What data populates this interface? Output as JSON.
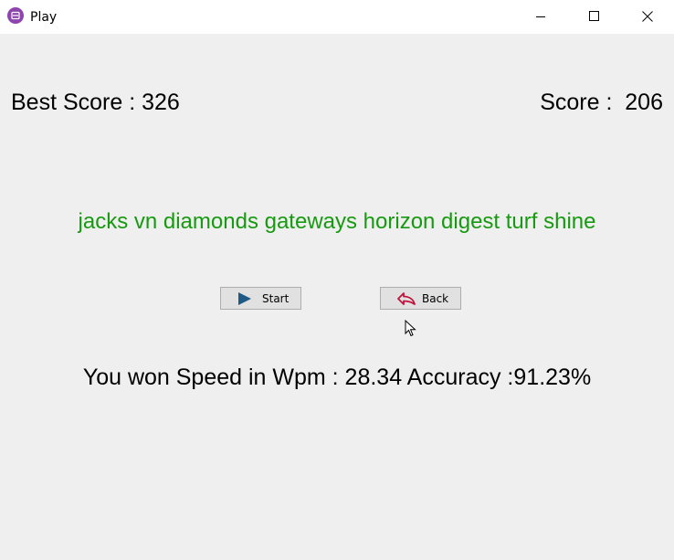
{
  "window": {
    "title": "Play",
    "icon": "app-icon",
    "controls": {
      "minimize_icon": "minimize-icon",
      "maximize_icon": "maximize-icon",
      "close_icon": "close-icon"
    }
  },
  "scores": {
    "best_score": "Best Score : 326",
    "score": "Score :  206"
  },
  "prompt": {
    "text": "jacks vn diamonds gateways horizon digest turf shine",
    "color": "#179a11"
  },
  "buttons": {
    "start_label": "Start",
    "start_icon": "play-icon",
    "back_label": "Back",
    "back_icon": "back-arrow-icon",
    "back_icon_color": "#c0143c"
  },
  "result": {
    "text": "You won Speed in Wpm : 28.34 Accuracy :91.23%"
  }
}
